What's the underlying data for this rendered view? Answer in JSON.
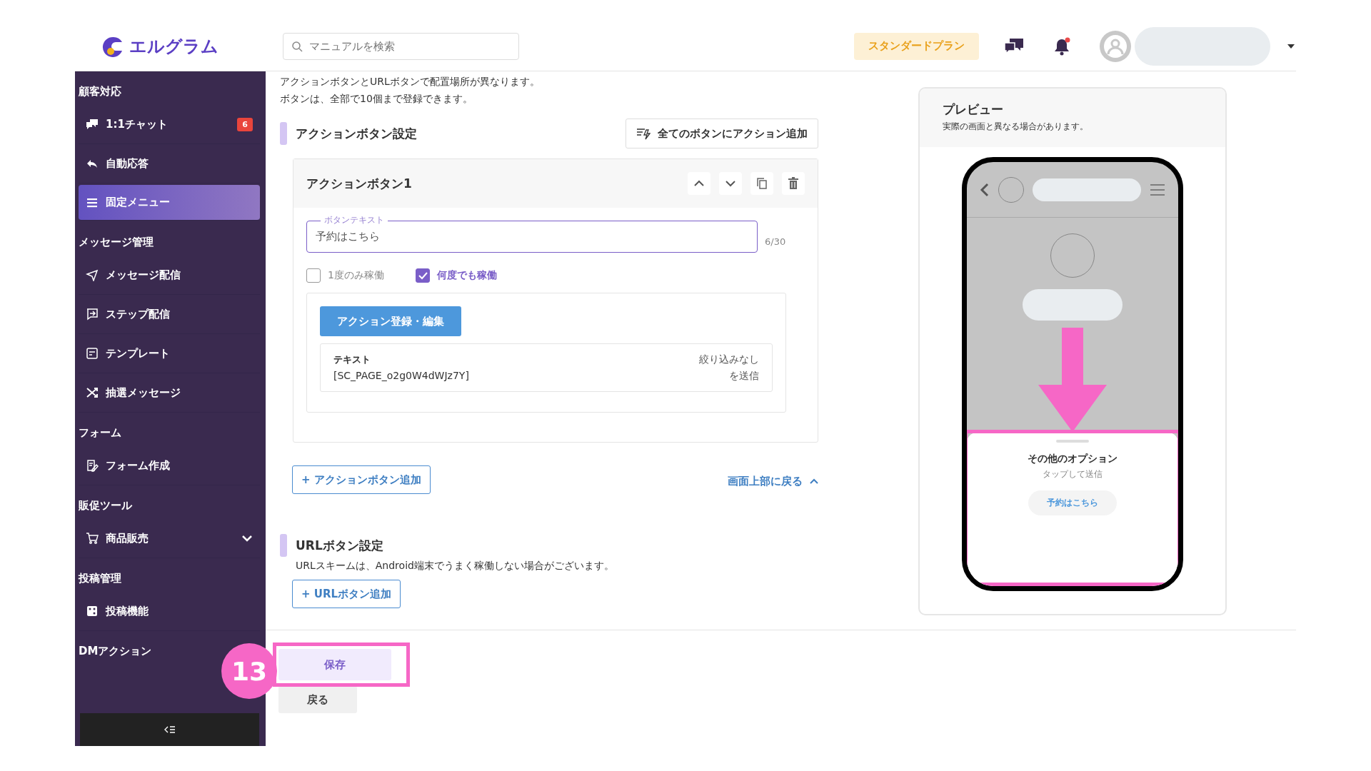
{
  "header": {
    "logo": "エルグラム",
    "search": {
      "placeholder": "マニュアルを検索"
    },
    "plan": "スタンダードプラン",
    "notification_dot": true
  },
  "sidebar": {
    "sections": [
      {
        "title": "顧客対応",
        "items": [
          {
            "label": "1:1チャット",
            "kind": "chat",
            "selected": false,
            "badge": "6"
          },
          {
            "label": "自動応答",
            "kind": "reply",
            "selected": false
          },
          {
            "label": "固定メニュー",
            "kind": "menu",
            "selected": true
          }
        ]
      },
      {
        "title": "メッセージ管理",
        "items": [
          {
            "label": "メッセージ配信",
            "kind": "send",
            "selected": false
          },
          {
            "label": "ステップ配信",
            "kind": "step",
            "selected": false
          },
          {
            "label": "テンプレート",
            "kind": "template",
            "selected": false
          },
          {
            "label": "抽選メッセージ",
            "kind": "shuffle",
            "selected": false
          }
        ]
      },
      {
        "title": "フォーム",
        "items": [
          {
            "label": "フォーム作成",
            "kind": "form",
            "selected": false
          }
        ]
      },
      {
        "title": "販促ツール",
        "items": [
          {
            "label": "商品販売",
            "kind": "cart",
            "selected": false,
            "expanded": false
          }
        ]
      },
      {
        "title": "投稿管理",
        "items": [
          {
            "label": "投稿機能",
            "kind": "post",
            "selected": false
          }
        ]
      },
      {
        "title": "DMアクション"
      }
    ]
  },
  "intro": [
    "アクションボタンとURLボタンで配置場所が異なります。",
    "ボタンは、全部で10個まで登録できます。"
  ],
  "action_section": {
    "title": "アクションボタン設定",
    "bulk_button": "全てのボタンにアクション追加",
    "card": {
      "title": "アクションボタン1",
      "field": {
        "label": "ボタンテキスト",
        "value": "予約はこちら",
        "counter": "6/30"
      },
      "options": [
        {
          "label": "1度のみ稼働",
          "checked": false
        },
        {
          "label": "何度でも稼働",
          "checked": true
        }
      ],
      "edit_button": "アクション登録・編集",
      "action": {
        "type": "テキスト",
        "value": "[SC_PAGE_o2g0W4dWJz7Y]",
        "filter": [
          "絞り込みなし",
          "を送信"
        ]
      }
    },
    "add_button": "+ アクションボタン追加",
    "top_link": "画面上部に戻る"
  },
  "url_section": {
    "title": "URLボタン設定",
    "note": "URLスキームは、Android端末でうまく稼働しない場合がございます。",
    "add_button": "+ URLボタン追加"
  },
  "footer": {
    "save": "保存",
    "back": "戻る"
  },
  "annotation": {
    "step": "13"
  },
  "preview": {
    "title": "プレビュー",
    "note": "実際の画面と異なる場合があります。",
    "sheet": {
      "title": "その他のオプション",
      "subtitle": "タップして送信",
      "button": "予約はこちら"
    }
  }
}
